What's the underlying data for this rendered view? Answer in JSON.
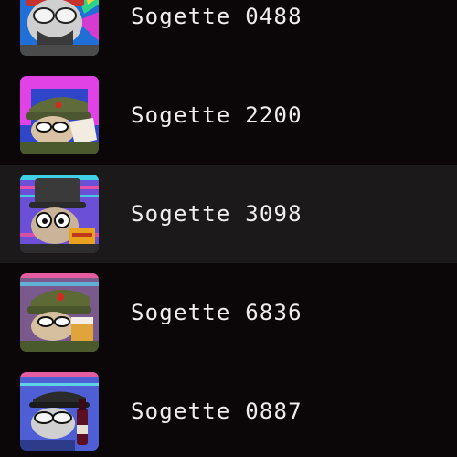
{
  "list": {
    "items": [
      {
        "name": "Sogette 0488",
        "avatar": "masked-soldier-avatar",
        "selected": false
      },
      {
        "name": "Sogette 2200",
        "avatar": "army-cap-avatar",
        "selected": false
      },
      {
        "name": "Sogette 3098",
        "avatar": "tophat-hamburger-avatar",
        "selected": true
      },
      {
        "name": "Sogette 6836",
        "avatar": "army-cap-beer-avatar",
        "selected": false
      },
      {
        "name": "Sogette 0887",
        "avatar": "officer-wine-avatar",
        "selected": false
      }
    ]
  },
  "colors": {
    "background": "#0b0708",
    "selected_row": "#1c191b",
    "text": "#f1edee"
  }
}
